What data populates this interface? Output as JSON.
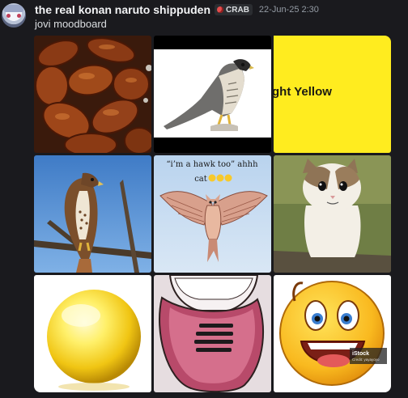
{
  "message": {
    "username": "the real konan naruto shippuden",
    "tag": {
      "label": "CRAB",
      "icon": "crab-icon"
    },
    "timestamp": "22-Jun-25 2:30",
    "content": "jovi moodboard"
  },
  "attachments": {
    "images": [
      {
        "alt": "chicken wings"
      },
      {
        "alt": "falcon"
      },
      {
        "alt": "yellow",
        "overlay_text": "ght Yellow",
        "color": "#ffec1f"
      },
      {
        "alt": "red-tailed hawk"
      },
      {
        "alt": "flying owl meme",
        "caption": "“i’m a hawk too” ahhh cat🤣🤣🤣"
      },
      {
        "alt": "cat"
      },
      {
        "alt": "yellow orb"
      },
      {
        "alt": "cartoon tongue"
      },
      {
        "alt": "laughing emoji",
        "watermark": "iStock",
        "credit": "Credit: yayayoyo"
      }
    ]
  },
  "colors": {
    "background": "#1a1a1e",
    "username": "#f2f3f5",
    "timestamp": "#949ba4",
    "tag_bg": "#2b2d31"
  }
}
